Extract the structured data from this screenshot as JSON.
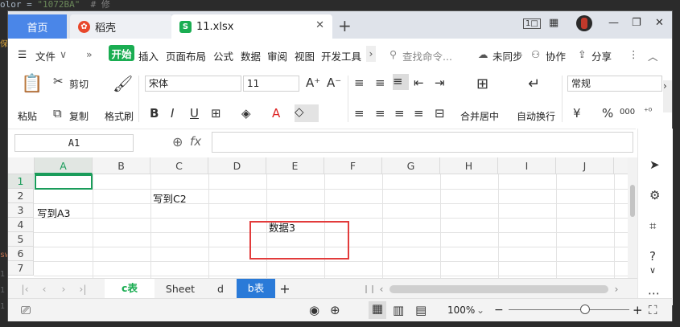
{
  "background_code": {
    "line1_prefix": "olor = ",
    "line1_string": "\"1072BA\"",
    "line1_comment": "# 修",
    "gutter_chars": [
      "保",
      "sw",
      "1",
      "1",
      "1"
    ]
  },
  "tabs": {
    "home": "首页",
    "daoke": "稻壳",
    "file": "11.xlsx",
    "file_icon": "S",
    "new_tab": "+"
  },
  "window_controls": {
    "layout": "1□",
    "grid": "▦",
    "minimize": "—",
    "restore": "❐",
    "close": "✕"
  },
  "menu": {
    "file": "文件",
    "expand": "»",
    "start": "开始",
    "items": [
      "插入",
      "页面布局",
      "公式",
      "数据",
      "审阅",
      "视图",
      "开发工具"
    ],
    "search": "查找命令...",
    "sync": "未同步",
    "collab": "协作",
    "share": "分享"
  },
  "ribbon": {
    "paste": "粘贴",
    "cut": "剪切",
    "copy": "复制",
    "format_painter": "格式刷",
    "font_name": "宋体",
    "font_size": "11",
    "bold": "B",
    "italic": "I",
    "underline": "U",
    "merge_center": "合并居中",
    "wrap_text": "自动换行",
    "number_format": "常规",
    "currency": "¥",
    "percent": "%",
    "thousands": "000"
  },
  "formula_bar": {
    "name_box": "A1",
    "fx": "fx",
    "zoom_icon": "⊕",
    "content": ""
  },
  "grid": {
    "columns": [
      "A",
      "B",
      "C",
      "D",
      "E",
      "F",
      "G",
      "H",
      "I",
      "J"
    ],
    "rows": [
      "1",
      "2",
      "3",
      "4",
      "5",
      "6",
      "7"
    ],
    "cells": {
      "C2": "写到C2",
      "A3": "写到A3",
      "E4": "数据3"
    },
    "selected": "A1"
  },
  "sheets": {
    "tabs": [
      "c表",
      "Sheet",
      "d",
      "b表"
    ],
    "active_index": 0,
    "highlight_index": 3,
    "add": "+"
  },
  "status": {
    "zoom": "100%",
    "zoom_level": 1.0,
    "minus": "−",
    "plus": "+"
  },
  "colors": {
    "accent_blue": "#4a86e8",
    "start_green": "#1aad52",
    "selection_green": "#1a9c5a",
    "highlight_red": "#e23b3b",
    "active_sheet_text": "#1aad52",
    "b_sheet_bg": "#2a7ad8"
  }
}
